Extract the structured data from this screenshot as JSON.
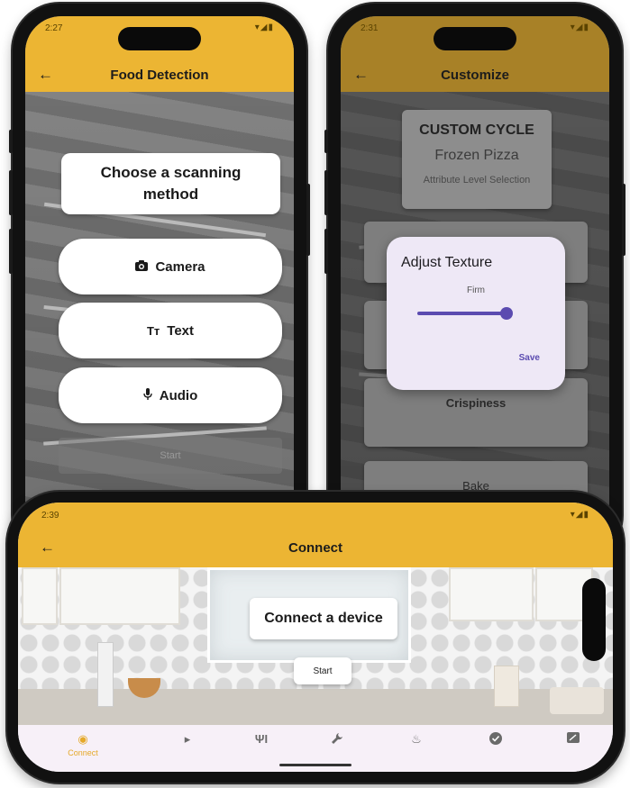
{
  "phone1": {
    "status_time": "2:27",
    "app_title": "Food Detection",
    "back_icon": "←",
    "heading": "Choose a scanning method",
    "options": [
      {
        "label": "Camera",
        "icon": "camera-icon",
        "glyph": "📷"
      },
      {
        "label": "Text",
        "icon": "text-icon",
        "glyph": "Tт"
      },
      {
        "label": "Audio",
        "icon": "microphone-icon",
        "glyph": "🎙"
      }
    ],
    "start_label": "Start"
  },
  "phone2": {
    "status_time": "2:31",
    "app_title": "Customize",
    "back_icon": "←",
    "cycle_title": "CUSTOM CYCLE",
    "cycle_food": "Frozen Pizza",
    "cycle_subtitle": "Attribute Level Selection",
    "tile_crispiness": "Crispiness",
    "tile_bake": "Bake",
    "dialog": {
      "title": "Adjust Texture",
      "slider_label": "Firm",
      "slider_value_fraction": 1.0,
      "save_label": "Save"
    }
  },
  "phone3": {
    "status_time": "2:39",
    "app_title": "Connect",
    "back_icon": "←",
    "heading": "Connect a device",
    "start_label": "Start",
    "nav": [
      {
        "label": "Connect",
        "icon": "connect-icon",
        "glyph": "◉"
      },
      {
        "label": "",
        "icon": "play-icon",
        "glyph": "▸"
      },
      {
        "label": "",
        "icon": "utensils-icon",
        "glyph": "ΨI"
      },
      {
        "label": "",
        "icon": "wrench-icon",
        "glyph": "🔧"
      },
      {
        "label": "",
        "icon": "flame-icon",
        "glyph": "♨"
      },
      {
        "label": "",
        "icon": "check-circle-icon",
        "glyph": "✔"
      },
      {
        "label": "",
        "icon": "feedback-icon",
        "glyph": "✎"
      }
    ]
  },
  "colors": {
    "appbar": "#ECB533",
    "nav_active": "#E5A92A",
    "slider": "#5B4BB0",
    "dialog_bg": "#EEE8F6"
  }
}
